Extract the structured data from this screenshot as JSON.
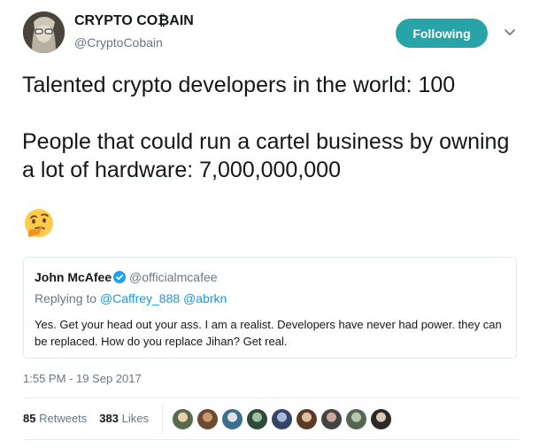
{
  "author": {
    "name": "CRYPTO CO₿AIN",
    "handle": "@CryptoCobain"
  },
  "follow_button": {
    "label": "Following",
    "color": "#28a4a8"
  },
  "tweet": {
    "line1": "Talented crypto developers in the world: 100",
    "line2": "People that could run a cartel business by owning a lot of hardware: 7,000,000,000",
    "emoji": "thinking-face-icon"
  },
  "quoted_tweet": {
    "name": "John McAfee",
    "verified": true,
    "handle": "@officialmcafee",
    "replying_prefix": "Replying to",
    "replying_to": "@Caffrey_888 @abrkn",
    "text": "Yes. Get your head out your ass. I am a realist. Developers have never had power. they can be replaced. How do you replace Jihan? Get real."
  },
  "timestamp": "1:55 PM - 19 Sep 2017",
  "stats": {
    "retweets_count": "85",
    "retweets_label": "Retweets",
    "likes_count": "383",
    "likes_label": "Likes"
  },
  "colors": {
    "link": "#1b95e0",
    "muted": "#657786",
    "accent": "#28a4a8"
  },
  "likers": [
    "avatar",
    "avatar",
    "avatar",
    "avatar",
    "avatar",
    "avatar",
    "avatar",
    "avatar",
    "avatar"
  ]
}
